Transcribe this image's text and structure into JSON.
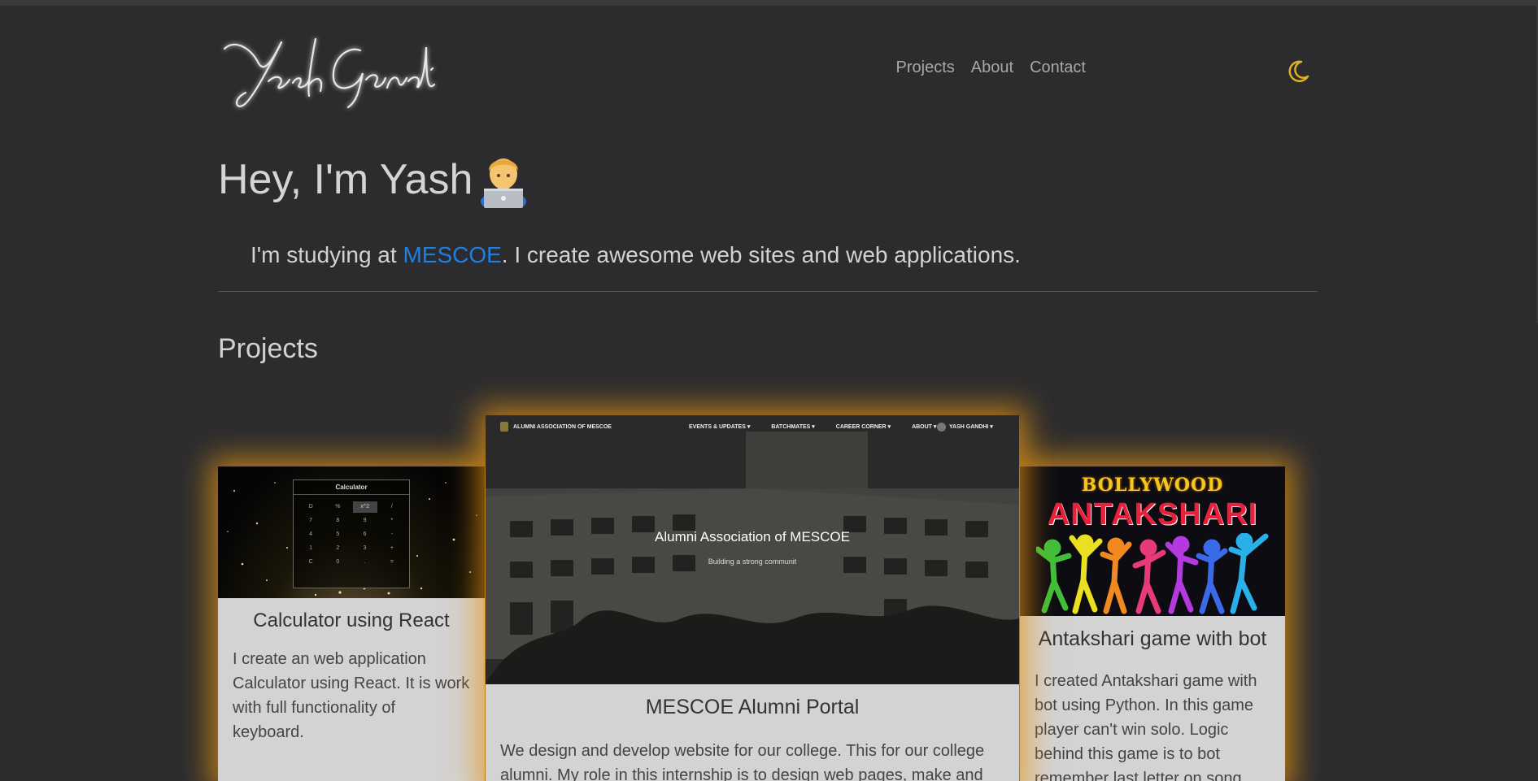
{
  "header": {
    "logo_text": "Yash Gandhi",
    "nav": [
      {
        "label": "Projects"
      },
      {
        "label": "About"
      },
      {
        "label": "Contact"
      }
    ],
    "theme_icon": "moon-icon",
    "theme_color": "#e0b020"
  },
  "hero": {
    "title": "Hey, I'm Yash",
    "emoji": "man-technologist-emoji",
    "tagline_before": "I'm studying at ",
    "tagline_link": "MESCOE",
    "tagline_after": ". I create awesome web sites and web applications.",
    "link_color": "#1e7fe0"
  },
  "projects": {
    "section_title": "Projects",
    "glow_color": "#e6961a",
    "cards": [
      {
        "title": "Calculator using React",
        "description": "I create an web application Calculator using React. It is work with full functionality of keyboard.",
        "thumb": {
          "app_title": "Calculator",
          "keys": [
            "D",
            "%",
            "x^2",
            "/",
            "7",
            "8",
            "9",
            "*",
            "4",
            "5",
            "6",
            "-",
            "1",
            "2",
            "3",
            "+",
            "C",
            "0",
            ".",
            "="
          ]
        }
      },
      {
        "title": "MESCOE Alumni Portal",
        "description": "We design and develop website for our college. This for our college alumni. My role in this internship is to design web pages, make and",
        "thumb": {
          "brand": "ALUMNI ASSOCIATION OF MESCOE",
          "nav": [
            "EVENTS & UPDATES ▾",
            "BATCHMATES ▾",
            "CAREER CORNER ▾",
            "ABOUT ▾"
          ],
          "user": "YASH GANDHI ▾",
          "heading": "Alumni Association of MESCOE",
          "subheading": "Building a strong communit"
        }
      },
      {
        "title": "Antakshari game with bot",
        "description": "I created Antakshari game with bot using Python. In this game player can't win solo. Logic behind this game is to bot remember last letter on song",
        "thumb": {
          "line1": "BOLLYWOOD",
          "line2": "ANTAKSHARI"
        }
      }
    ]
  }
}
